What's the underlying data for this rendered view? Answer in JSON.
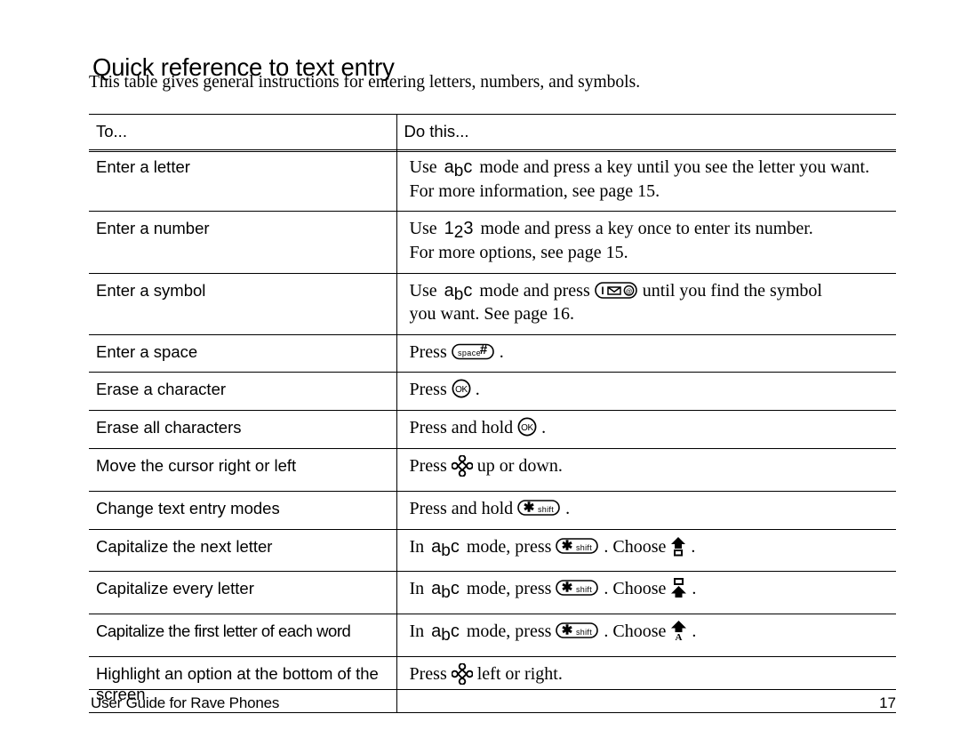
{
  "document": {
    "title": "Quick reference to text entry",
    "intro": "This table gives general instructions for entering letters, numbers, and symbols."
  },
  "table": {
    "headers": {
      "to": "To...",
      "do": "Do this..."
    },
    "rows": [
      {
        "to": "Enter a letter",
        "do_lines": [
          {
            "parts": [
              {
                "type": "text",
                "value": "Use"
              },
              {
                "type": "mode",
                "value": "abc"
              },
              {
                "type": "text",
                "value": "mode and press a key until you see the letter you want."
              }
            ]
          },
          {
            "parts": [
              {
                "type": "text",
                "value": "For more information, see page 15."
              }
            ]
          }
        ]
      },
      {
        "to": "Enter a number",
        "do_lines": [
          {
            "parts": [
              {
                "type": "text",
                "value": "Use"
              },
              {
                "type": "mode",
                "value": "123"
              },
              {
                "type": "text",
                "value": "mode and press a key once to enter its number."
              }
            ]
          },
          {
            "parts": [
              {
                "type": "text",
                "value": "For more options, see page 15."
              }
            ]
          }
        ]
      },
      {
        "to": "Enter a symbol",
        "do_lines": [
          {
            "parts": [
              {
                "type": "text",
                "value": "Use"
              },
              {
                "type": "mode",
                "value": "abc"
              },
              {
                "type": "text",
                "value": "mode and press"
              },
              {
                "type": "key",
                "value": "one-envelope-at-key"
              },
              {
                "type": "text",
                "value": "until you find the symbol"
              }
            ]
          },
          {
            "parts": [
              {
                "type": "text",
                "value": "you want. See page 16."
              }
            ]
          }
        ]
      },
      {
        "to": "Enter a space",
        "do_lines": [
          {
            "parts": [
              {
                "type": "text",
                "value": "Press"
              },
              {
                "type": "key",
                "value": "space-pound-key"
              },
              {
                "type": "text",
                "value": "."
              }
            ]
          }
        ]
      },
      {
        "to": "Erase a character",
        "do_lines": [
          {
            "parts": [
              {
                "type": "text",
                "value": "Press"
              },
              {
                "type": "key",
                "value": "ok-key"
              },
              {
                "type": "text",
                "value": "."
              }
            ]
          }
        ]
      },
      {
        "to": "Erase all characters",
        "do_lines": [
          {
            "parts": [
              {
                "type": "text",
                "value": "Press and hold"
              },
              {
                "type": "key",
                "value": "ok-key"
              },
              {
                "type": "text",
                "value": "."
              }
            ]
          }
        ]
      },
      {
        "to": "Move the cursor right or left",
        "do_lines": [
          {
            "parts": [
              {
                "type": "text",
                "value": "Press"
              },
              {
                "type": "key",
                "value": "navigation-pad-key"
              },
              {
                "type": "text",
                "value": "up or down."
              }
            ]
          }
        ]
      },
      {
        "to": "Change text entry modes",
        "do_lines": [
          {
            "parts": [
              {
                "type": "text",
                "value": "Press and hold"
              },
              {
                "type": "key",
                "value": "shift-key"
              },
              {
                "type": "text",
                "value": "."
              }
            ]
          }
        ]
      },
      {
        "to": "Capitalize the next letter",
        "do_lines": [
          {
            "parts": [
              {
                "type": "text",
                "value": "In"
              },
              {
                "type": "mode",
                "value": "abc"
              },
              {
                "type": "text",
                "value": "mode, press"
              },
              {
                "type": "key",
                "value": "shift-key"
              },
              {
                "type": "text",
                "value": ". Choose"
              },
              {
                "type": "key",
                "value": "shift-once-indicator"
              },
              {
                "type": "text",
                "value": "."
              }
            ]
          }
        ]
      },
      {
        "to": "Capitalize every letter",
        "do_lines": [
          {
            "parts": [
              {
                "type": "text",
                "value": "In"
              },
              {
                "type": "mode",
                "value": "abc"
              },
              {
                "type": "text",
                "value": "mode, press"
              },
              {
                "type": "key",
                "value": "shift-key"
              },
              {
                "type": "text",
                "value": ". Choose"
              },
              {
                "type": "key",
                "value": "caps-lock-indicator"
              },
              {
                "type": "text",
                "value": "."
              }
            ]
          }
        ]
      },
      {
        "to": "Capitalize the first letter of each word",
        "do_lines": [
          {
            "parts": [
              {
                "type": "text",
                "value": "In"
              },
              {
                "type": "mode",
                "value": "abc"
              },
              {
                "type": "text",
                "value": "mode, press"
              },
              {
                "type": "key",
                "value": "shift-key"
              },
              {
                "type": "text",
                "value": ". Choose"
              },
              {
                "type": "key",
                "value": "word-caps-indicator"
              },
              {
                "type": "text",
                "value": "."
              }
            ]
          }
        ]
      },
      {
        "to": "Highlight an option at the bottom of the screen",
        "do_lines": [
          {
            "parts": [
              {
                "type": "text",
                "value": "Press"
              },
              {
                "type": "key",
                "value": "navigation-pad-key"
              },
              {
                "type": "text",
                "value": "left or right."
              }
            ]
          }
        ]
      }
    ]
  },
  "keycaps": {
    "one-envelope-at-key": {
      "labels": [
        "1",
        "envelope",
        "@"
      ]
    },
    "space-pound-key": {
      "labels": [
        "space",
        "#"
      ]
    },
    "ok-key": {
      "labels": [
        "OK"
      ]
    },
    "shift-key": {
      "labels": [
        "*",
        "shift"
      ]
    },
    "navigation-pad-key": {
      "labels": []
    },
    "shift-once-indicator": {
      "labels": []
    },
    "caps-lock-indicator": {
      "labels": []
    },
    "word-caps-indicator": {
      "labels": [
        "A"
      ]
    }
  },
  "footer": {
    "left": "User Guide for Rave Phones",
    "page_number": "17"
  }
}
